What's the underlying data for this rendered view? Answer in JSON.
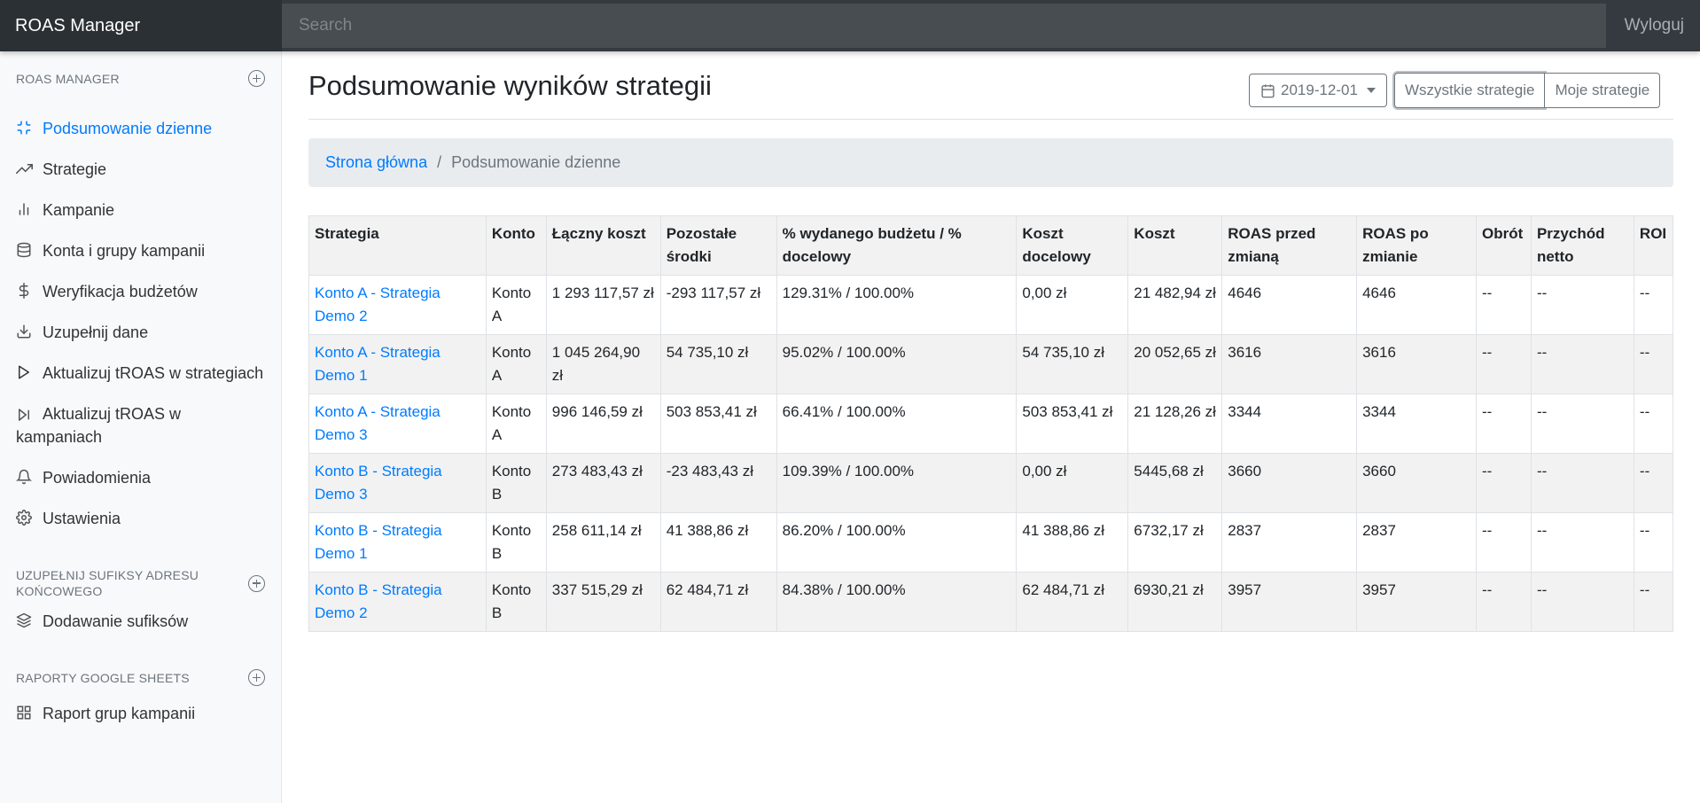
{
  "navbar": {
    "brand": "ROAS Manager",
    "search_placeholder": "Search",
    "logout": "Wyloguj"
  },
  "sidebar": {
    "sections": [
      {
        "heading": "ROAS MANAGER",
        "items": [
          {
            "label": "Podsumowanie dzienne",
            "icon": "minimize-icon",
            "active": true
          },
          {
            "label": "Strategie",
            "icon": "trending-up-icon"
          },
          {
            "label": "Kampanie",
            "icon": "bar-chart-icon"
          },
          {
            "label": "Konta i grupy kampanii",
            "icon": "database-icon"
          },
          {
            "label": "Weryfikacja budżetów",
            "icon": "dollar-icon"
          },
          {
            "label": "Uzupełnij dane",
            "icon": "download-icon"
          },
          {
            "label": "Aktualizuj tROAS w strategiach",
            "icon": "play-icon"
          },
          {
            "label": "Aktualizuj tROAS w kampaniach",
            "icon": "skip-forward-icon"
          },
          {
            "label": "Powiadomienia",
            "icon": "bell-icon"
          },
          {
            "label": "Ustawienia",
            "icon": "settings-icon"
          }
        ]
      },
      {
        "heading": "UZUPEŁNIJ SUFIKSY ADRESU KOŃCOWEGO",
        "items": [
          {
            "label": "Dodawanie sufiksów",
            "icon": "layers-icon"
          }
        ]
      },
      {
        "heading": "RAPORTY GOOGLE SHEETS",
        "items": [
          {
            "label": "Raport grup kampanii",
            "icon": "grid-icon"
          }
        ]
      }
    ]
  },
  "page": {
    "title": "Podsumowanie wyników strategii",
    "date": "2019-12-01",
    "filter_all": "Wszystkie strategie",
    "filter_mine": "Moje strategie",
    "breadcrumb_home": "Strona główna",
    "breadcrumb_sep": "/",
    "breadcrumb_current": "Podsumowanie dzienne"
  },
  "table": {
    "headers": [
      "Strategia",
      "Konto",
      "Łączny koszt",
      "Pozostałe środki",
      "% wydanego budżetu / % docelowy",
      "Koszt docelowy",
      "Koszt",
      "ROAS przed zmianą",
      "ROAS po zmianie",
      "Obrót",
      "Przychód netto",
      "ROI"
    ],
    "rows": [
      [
        "Konto A - Strategia Demo 2",
        "Konto A",
        "1 293 117,57 zł",
        "-293 117,57 zł",
        "129.31% / 100.00%",
        "0,00 zł",
        "21 482,94 zł",
        "4646",
        "4646",
        "--",
        "--",
        "--"
      ],
      [
        "Konto A - Strategia Demo 1",
        "Konto A",
        "1 045 264,90 zł",
        "54 735,10 zł",
        "95.02% / 100.00%",
        "54 735,10 zł",
        "20 052,65 zł",
        "3616",
        "3616",
        "--",
        "--",
        "--"
      ],
      [
        "Konto A - Strategia Demo 3",
        "Konto A",
        "996 146,59 zł",
        "503 853,41 zł",
        "66.41% / 100.00%",
        "503 853,41 zł",
        "21 128,26 zł",
        "3344",
        "3344",
        "--",
        "--",
        "--"
      ],
      [
        "Konto B - Strategia Demo 3",
        "Konto B",
        "273 483,43 zł",
        "-23 483,43 zł",
        "109.39% / 100.00%",
        "0,00 zł",
        "5445,68 zł",
        "3660",
        "3660",
        "--",
        "--",
        "--"
      ],
      [
        "Konto B - Strategia Demo 1",
        "Konto B",
        "258 611,14 zł",
        "41 388,86 zł",
        "86.20% / 100.00%",
        "41 388,86 zł",
        "6732,17 zł",
        "2837",
        "2837",
        "--",
        "--",
        "--"
      ],
      [
        "Konto B - Strategia Demo 2",
        "Konto B",
        "337 515,29 zł",
        "62 484,71 zł",
        "84.38% / 100.00%",
        "62 484,71 zł",
        "6930,21 zł",
        "3957",
        "3957",
        "--",
        "--",
        "--"
      ]
    ]
  },
  "colors": {
    "navbar": "#343a40",
    "brand_bg": "#2b3035",
    "link": "#007bff",
    "sidebar_bg": "#f8f9fa"
  }
}
